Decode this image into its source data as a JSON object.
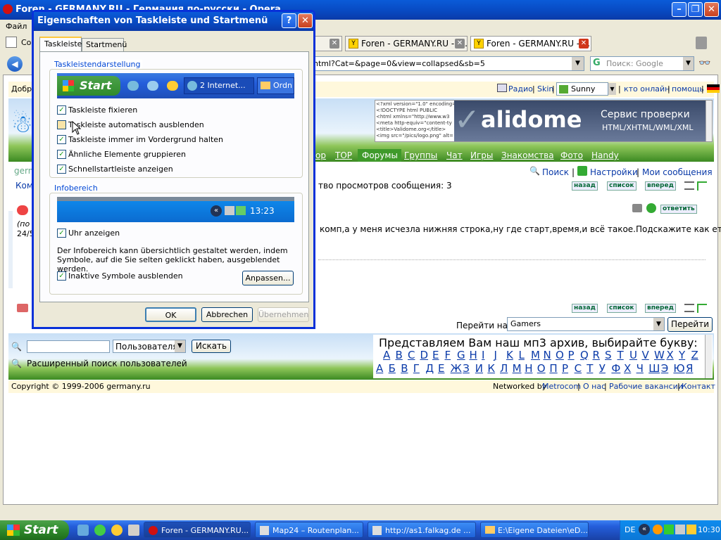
{
  "browser": {
    "title": "Foren - GERMANY.RU - Германия по-русски - Opera",
    "menu_file": "Файл",
    "menu_fragment": "Co",
    "tabs": [
      {
        "label": "Foren - GERMANY.RU - Г..."
      },
      {
        "label": "Foren - GERMANY.RU - Г..."
      }
    ],
    "address": "html?Cat=&page=0&view=collapsed&sb=5",
    "search_placeholder": "Поиск: Google"
  },
  "site": {
    "greeting": "Добро",
    "top_links": [
      "Радио",
      "Skin",
      "кто онлайн",
      "помощь"
    ],
    "skin_value": "Sunny",
    "separator": "|",
    "ad_code": [
      "<?xml version=\"1.0\" encoding=",
      "<!DOCTYPE html PUBLIC",
      "<html xmlns=\"http://www.w3",
      "<meta http-equiv=\"content-ty",
      "<title>Validome.org</title>",
      "<img src=\"/pics/logo.png\" alt="
    ],
    "ad_brand": "alidome",
    "ad_line1": "Сервис проверки",
    "ad_line2": "HTML/XHTML/WML/XML",
    "nav": [
      "ор",
      "TOP",
      "Форумы",
      "Группы",
      "Чат",
      "Игры",
      "Знакомства",
      "Фото",
      "Handy"
    ],
    "nav_active": "Форумы",
    "links_right": [
      "Поиск",
      "Настройки",
      "Мои сообщения"
    ],
    "left_fragments": [
      "germ",
      "Ком",
      "(по",
      "24/5"
    ],
    "views_text": "тво просмотров сообщения: 3",
    "btn_back": "назад",
    "btn_list": "список",
    "btn_forward": "вперед",
    "btn_reply": "ответить",
    "message": "комп,а у меня исчезла нижняя строка,ну где старт,время,и всё такое.Подскажите как ету",
    "goto_label": "Перейти на",
    "goto_value": "Gamers",
    "goto_button": "Перейти",
    "user_scope": "Пользователя",
    "search_button": "Искать",
    "advanced_search": "Расширенный поиск пользователей",
    "mp3_title": "Представляем Вам наш мп3 архив, выбирайте букву:",
    "latin": [
      "A",
      "B",
      "C",
      "D",
      "E",
      "F",
      "G",
      "H",
      "I",
      "J",
      "K",
      "L",
      "M",
      "N",
      "O",
      "P",
      "Q",
      "R",
      "S",
      "T",
      "U",
      "V",
      "W",
      "X",
      "Y",
      "Z"
    ],
    "cyrillic": [
      "А",
      "Б",
      "В",
      "Г",
      "Д",
      "Е",
      "Ж",
      "З",
      "И",
      "К",
      "Л",
      "М",
      "Н",
      "О",
      "П",
      "Р",
      "С",
      "Т",
      "У",
      "Ф",
      "Х",
      "Ч",
      "Ш",
      "Э",
      "Ю",
      "Я"
    ],
    "copyright": "Copyright © 1999-2006 germany.ru",
    "networked_by": "Networked by",
    "metrocom": "Metrocom",
    "footer_links": [
      "О нас",
      "Рабочие вакансии",
      "Контакт"
    ]
  },
  "dialog": {
    "title": "Eigenschaften von Taskleiste und Startmenü",
    "help_glyph": "?",
    "close_glyph": "✕",
    "tabs": [
      "Taskleiste",
      "Startmenü"
    ],
    "group1_title": "Taskleistendarstellung",
    "preview_start": "Start",
    "preview_task1": "2 Internet...",
    "preview_task2": "Ordn",
    "options": [
      {
        "label": "Taskleiste fixieren",
        "checked": true
      },
      {
        "label": "Taskleiste automatisch ausblenden",
        "checked": false
      },
      {
        "label": "Taskleiste immer im Vordergrund halten",
        "checked": true
      },
      {
        "label": "Ähnliche Elemente gruppieren",
        "checked": true
      },
      {
        "label": "Schnellstartleiste anzeigen",
        "checked": true
      }
    ],
    "group2_title": "Infobereich",
    "preview_clock": "13:23",
    "show_clock_label": "Uhr anzeigen",
    "info_text": "Der Infobereich kann übersichtlich gestaltet werden, indem Symbole, auf die Sie selten geklickt haben, ausgeblendet werden.",
    "hide_inactive_label": "Inaktive Symbole ausblenden",
    "customize_button": "Anpassen...",
    "ok_button": "OK",
    "cancel_button": "Abbrechen",
    "apply_button": "Übernehmen",
    "check_glyph": "✓"
  },
  "taskbar": {
    "start": "Start",
    "items": [
      "Foren - GERMANY.RU...",
      "Map24 – Routenplan...",
      "http://as1.falkag.de ...",
      "E:\\Eigene Dateien\\eD..."
    ],
    "lang": "DE",
    "clock": "10:30"
  },
  "colors": {
    "xp_blue": "#0a5bd8",
    "start_green": "#2f8a2c",
    "link_blue": "#0a3aa8",
    "nav_active_bg": "#3f9a2a"
  }
}
